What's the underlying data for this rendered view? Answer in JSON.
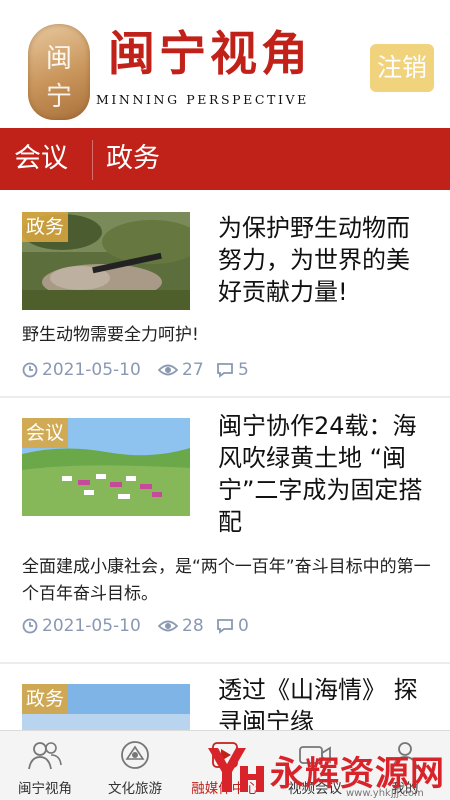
{
  "header": {
    "seal_text": "闽宁",
    "title": "闽宁视角",
    "subtitle": "MINNING PERSPECTIVE",
    "logout_label": "注销"
  },
  "categories": [
    {
      "label": "会议"
    },
    {
      "label": "政务"
    }
  ],
  "articles": [
    {
      "tag": "政务",
      "title": "为保护野生动物而努力，为世界的美好贡献力量!",
      "summary": "野生动物需要全力呵护!",
      "date": "2021-05-10",
      "views": "27",
      "comments": "5"
    },
    {
      "tag": "会议",
      "title": "闽宁协作24载：海风吹绿黄土地 “闽宁”二字成为固定搭配",
      "summary": "全面建成小康社会，是“两个一百年”奋斗目标中的第一个百年奋斗目标。",
      "date": "2021-05-10",
      "views": "28",
      "comments": "0"
    },
    {
      "tag": "政务",
      "title": "透过《山海情》 探寻闽宁缘"
    }
  ],
  "tabbar": {
    "items": [
      {
        "label": "闽宁视角",
        "icon": "people-icon"
      },
      {
        "label": "文化旅游",
        "icon": "travel-icon"
      },
      {
        "label": "融媒体中心",
        "icon": "media-icon"
      },
      {
        "label": "视频会议",
        "icon": "video-icon"
      },
      {
        "label": "我的",
        "icon": "user-icon"
      }
    ],
    "active_index": 2
  },
  "watermark": {
    "logo_text": "永辉资源网",
    "url": "www.yhkjjj.com"
  },
  "colors": {
    "brand_red": "#c0221a",
    "logout_bg": "#f1d37e",
    "tag_bg": "#d9a640",
    "meta_gray": "#8a99b3"
  }
}
